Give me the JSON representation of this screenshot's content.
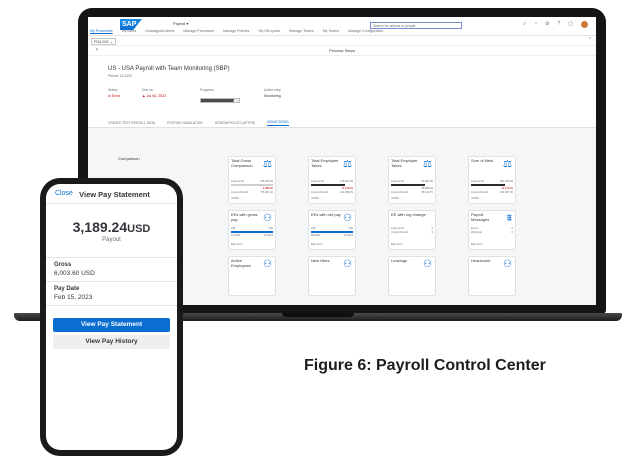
{
  "shell": {
    "logo": "SAP",
    "app_title": "Payroll ▾",
    "nav": [
      "My Processes",
      "My Alerts",
      "Unassigned Alerts",
      "Manage Processes",
      "Manage Policies",
      "My Off-cycles",
      "Manage Teams",
      "My Teams",
      "Manage Configuration"
    ],
    "search_placeholder": "Search for actions or people"
  },
  "context": {
    "selector": "FD4-201 ⌄"
  },
  "steps": {
    "title": "Process Steps"
  },
  "process": {
    "title": "US - USA Payroll with Team Monitoring (SBP)",
    "period": "Period 13.2022",
    "status_label": "Status",
    "status_value": "Error",
    "due_label": "Due on",
    "due_value": "Jul 04, 2022",
    "progress_label": "Progress",
    "progress_value": "7/8",
    "progress_fraction": 0.875,
    "active_step_label": "Active step",
    "active_step_value": "Monitoring"
  },
  "tabs": [
    "CREATE TEST PAYROLL DATA",
    "POSTING SIMULATION",
    "INTERIM POLICY (AFTER)",
    "MONITORING"
  ],
  "comparison_label": "Comparison",
  "tiles": [
    {
      "title": "Total Gross Comparison",
      "l1": "Last period",
      "v1": "786,209.45",
      "l2": "",
      "v2": "4,388.00",
      "f1": "Current Period",
      "f2": "776,451.02",
      "footer": "(USD)"
    },
    {
      "title": "Total Employee Taxes",
      "l1": "Last period",
      "v1": "178,602.38",
      "l2": "",
      "v2": "72,378.29",
      "f1": "Current Period",
      "f2": "214,898.29",
      "footer": "(USD)"
    },
    {
      "title": "Total Employer Taxes",
      "l1": "Last period",
      "v1": "64,882.90",
      "l2": "",
      "v2": "96,888.63",
      "f1": "Current Period",
      "f2": "58,412.70",
      "footer": "(USD)"
    },
    {
      "title": "Sum of Nets",
      "l1": "Last period",
      "v1": "382,189.39",
      "l2": "",
      "v2": "62,079.01",
      "f1": "Current Period",
      "f2": "321,567.30",
      "footer": "(USD)"
    },
    {
      "title": "EEs with gross pay",
      "l1": "236",
      "v1": "230",
      "f1": "91.3003",
      "f2": "13.3003",
      "footer": "EE count"
    },
    {
      "title": "EEs with net pay",
      "l1": "230",
      "v1": "230",
      "f1": "88.2003",
      "f2": "13.3003",
      "footer": "EE count"
    },
    {
      "title": "EE with org change",
      "l1": "Last period",
      "v1": "2",
      "f1": "Current Period",
      "f2": "3",
      "footer": "EE count"
    },
    {
      "title": "Payroll Messages",
      "l1": "Errors",
      "v1": "0",
      "f1": "Warnings",
      "f2": "0",
      "footer": "EE count"
    },
    {
      "title": "Active Employees"
    },
    {
      "title": "New Hires"
    },
    {
      "title": "Leavings"
    },
    {
      "title": "Headcount"
    }
  ],
  "phone": {
    "close_label": "Close",
    "title": "View Pay Statement",
    "amount": "3,189.24",
    "currency": "USD",
    "payout_label": "Payout",
    "gross_label": "Gross",
    "gross_value": "6,003.60 USD",
    "pay_date_label": "Pay Date",
    "pay_date_value": "Feb 15, 2023",
    "primary_button": "View Pay Statement",
    "secondary_button": "View Pay History"
  },
  "caption": "Figure 6: Payroll Control Center",
  "colors": {
    "accent": "#0a6ed1",
    "error": "#bb0000"
  }
}
